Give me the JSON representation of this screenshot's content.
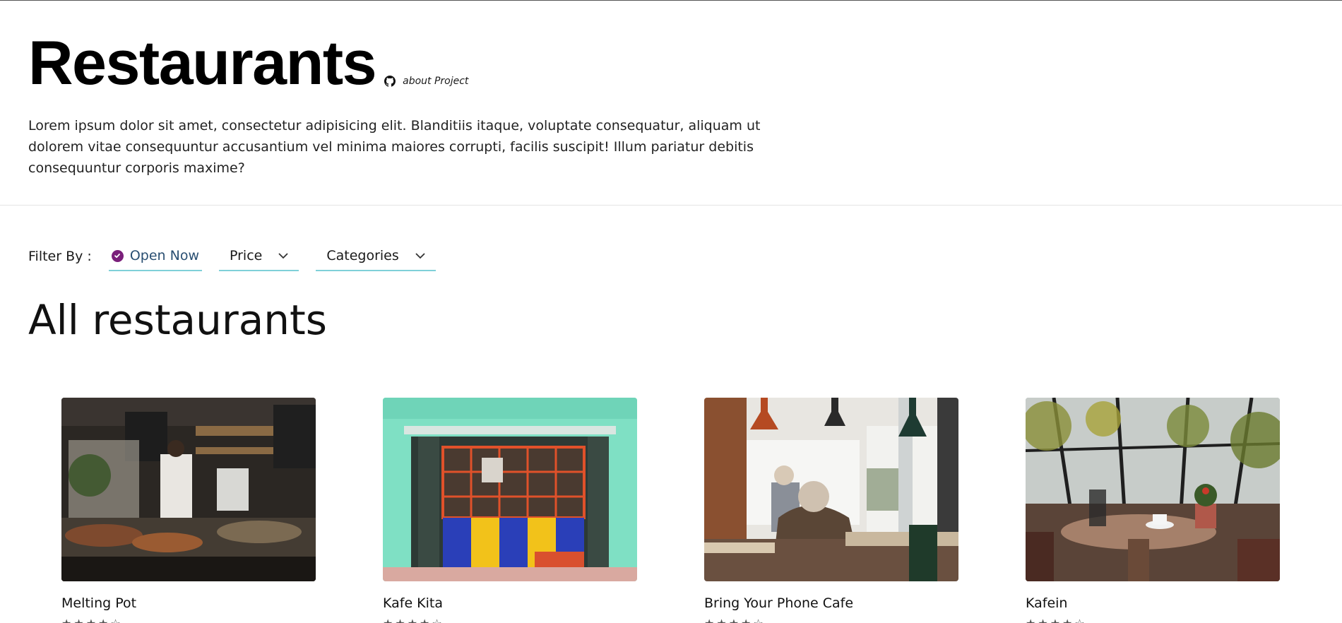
{
  "header": {
    "title": "Restaurants",
    "about_link": "about Project",
    "about_icon": "github-icon",
    "description": "Lorem ipsum dolor sit amet, consectetur adipisicing elit. Blanditiis itaque, voluptate consequatur, aliquam ut dolorem vitae consequuntur accusantium vel minima maiores corrupti, facilis suscipit! Illum pariatur debitis consequuntur corporis maxime?"
  },
  "filters": {
    "label": "Filter By :",
    "open_now": "Open Now",
    "price": "Price",
    "categories": "Categories",
    "accent_color": "#7fd0d9",
    "check_color": "#7a1f7a"
  },
  "section": {
    "title": "All restaurants"
  },
  "restaurants": [
    {
      "name": "Melting Pot",
      "stars": "★★★★☆"
    },
    {
      "name": "Kafe Kita",
      "stars": "★★★★☆"
    },
    {
      "name": "Bring Your Phone Cafe",
      "stars": "★★★★☆"
    },
    {
      "name": "Kafein",
      "stars": "★★★★☆"
    }
  ]
}
